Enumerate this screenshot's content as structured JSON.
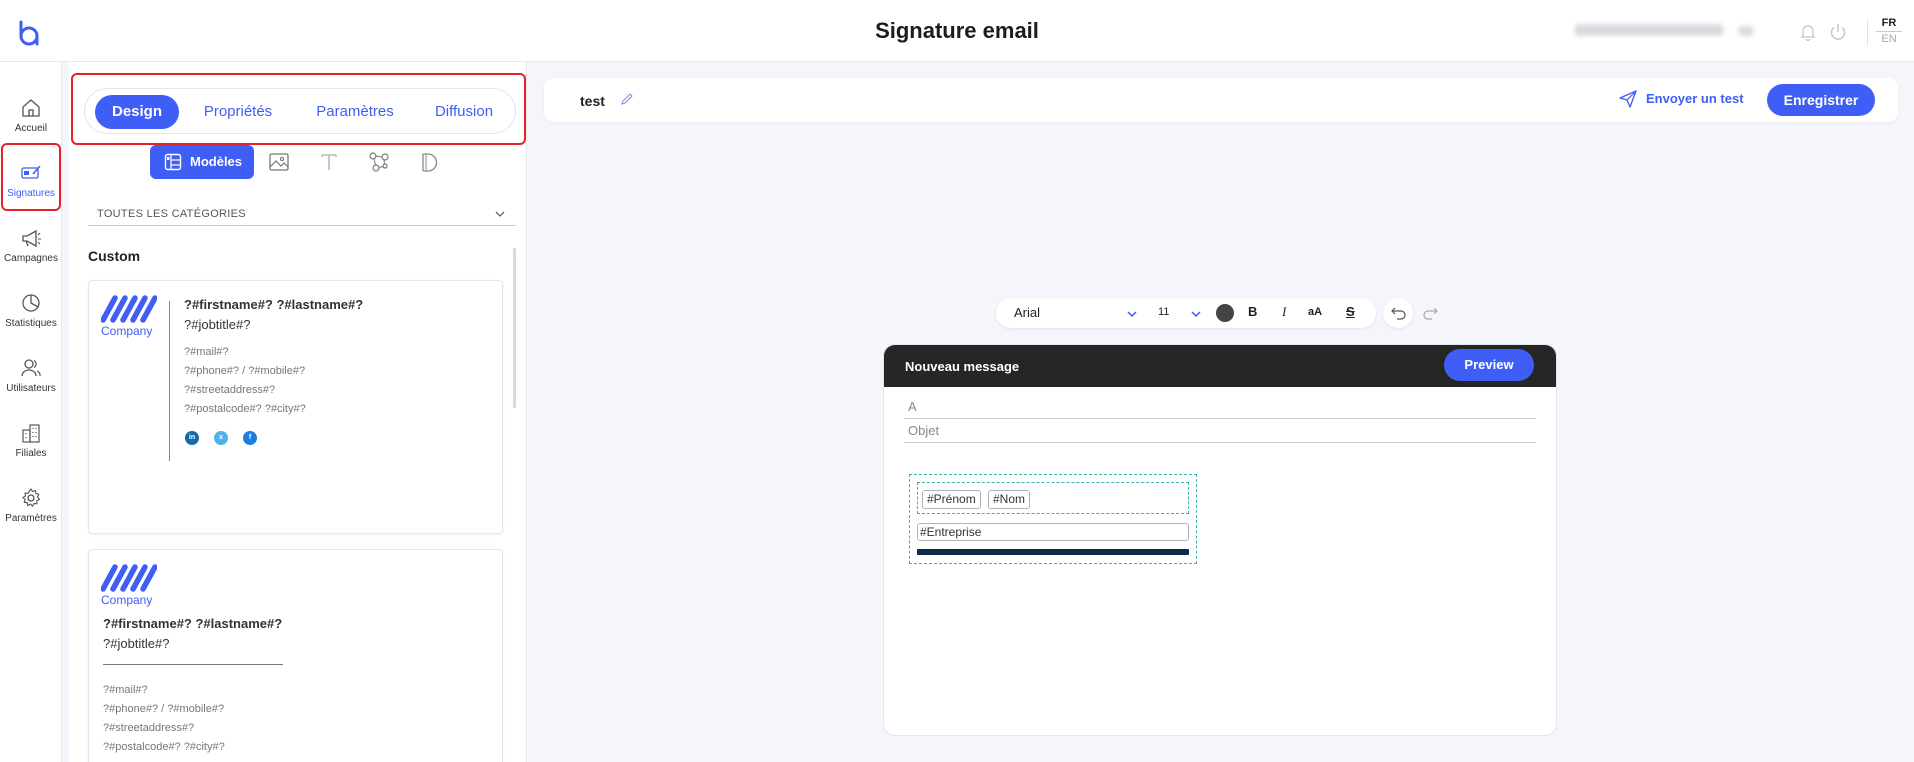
{
  "header": {
    "title": "Signature email",
    "lang_active": "FR",
    "lang_other": "EN"
  },
  "nav": {
    "items": [
      {
        "label": "Accueil",
        "icon": "home-icon"
      },
      {
        "label": "Signatures",
        "icon": "signature-icon"
      },
      {
        "label": "Campagnes",
        "icon": "megaphone-icon"
      },
      {
        "label": "Statistiques",
        "icon": "pie-chart-icon"
      },
      {
        "label": "Utilisateurs",
        "icon": "users-icon"
      },
      {
        "label": "Filiales",
        "icon": "buildings-icon"
      },
      {
        "label": "Paramètres",
        "icon": "gear-icon"
      }
    ],
    "active": "Signatures"
  },
  "panel": {
    "tabs": [
      "Design",
      "Propriétés",
      "Paramètres",
      "Diffusion"
    ],
    "active_tab": "Design",
    "modeles_label": "Modèles",
    "category_select": "TOUTES LES CATÉGORIES",
    "section_title": "Custom",
    "templates": [
      {
        "company": "Company",
        "name": "?#firstname#? ?#lastname#?",
        "job": "?#jobtitle#?",
        "lines": [
          "?#mail#?",
          "?#phone#? / ?#mobile#?",
          "?#streetaddress#?",
          "?#postalcode#? ?#city#?"
        ],
        "social": [
          "in",
          "x",
          "f"
        ]
      },
      {
        "company": "Company",
        "name": "?#firstname#? ?#lastname#?",
        "job": "?#jobtitle#?",
        "lines": [
          "?#mail#?",
          "?#phone#? / ?#mobile#?",
          "?#streetaddress#?",
          "?#postalcode#? ?#city#?"
        ]
      }
    ]
  },
  "editor": {
    "signature_name": "test",
    "send_test_label": "Envoyer un test",
    "save_label": "Enregistrer",
    "toolbar": {
      "font_family": "Arial",
      "font_size": "11",
      "bold": "B",
      "italic": "I",
      "case": "aA",
      "strike": "S"
    },
    "mail": {
      "title": "Nouveau message",
      "preview_label": "Preview",
      "to_placeholder": "A",
      "subject_placeholder": "Objet",
      "tag_firstname": "#Prénom",
      "tag_lastname": "#Nom",
      "tag_company": "#Entreprise"
    }
  },
  "colors": {
    "accent": "#3e5ef5",
    "highlight": "#e2232a",
    "mail_header": "#262626",
    "dashed": "#36b6ad"
  }
}
